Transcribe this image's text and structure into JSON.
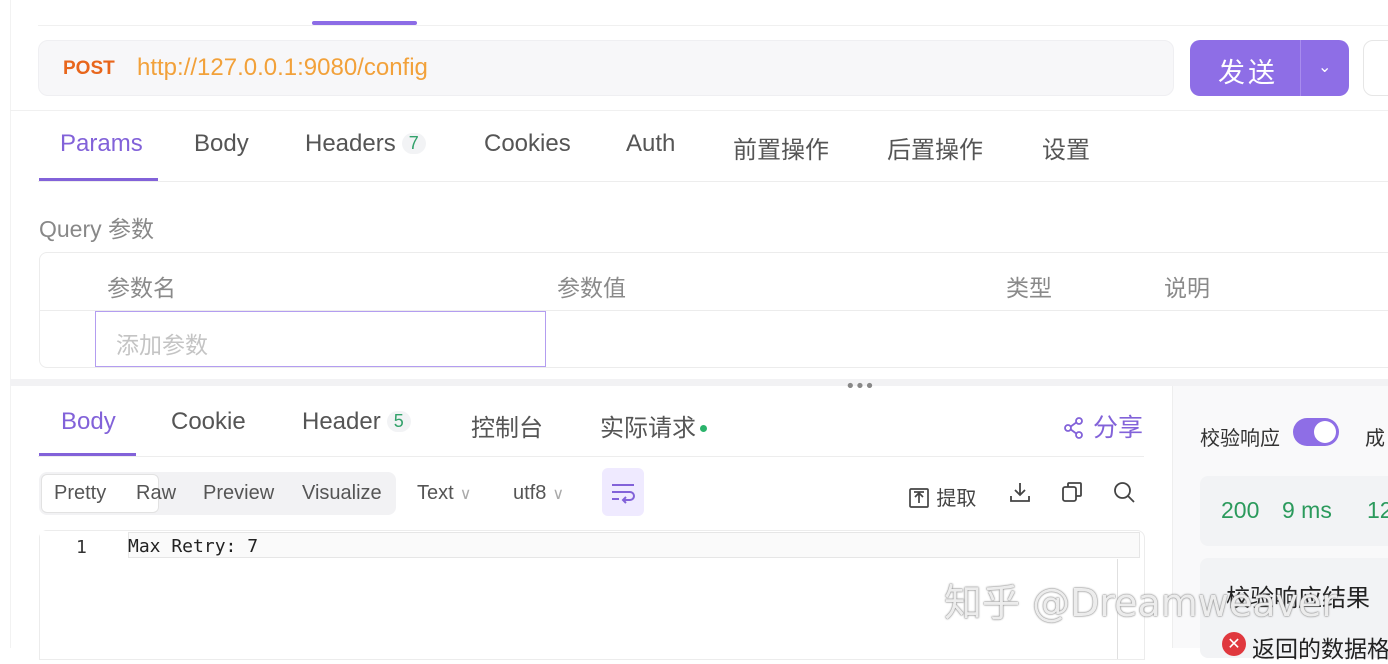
{
  "request": {
    "method": "POST",
    "url": "http://127.0.0.1:9080/config",
    "send_label": "发送"
  },
  "request_tabs": [
    {
      "label": "Params"
    },
    {
      "label": "Body"
    },
    {
      "label": "Headers",
      "badge": "7"
    },
    {
      "label": "Cookies"
    },
    {
      "label": "Auth"
    },
    {
      "label": "前置操作"
    },
    {
      "label": "后置操作"
    },
    {
      "label": "设置"
    }
  ],
  "query": {
    "title": "Query 参数",
    "columns": [
      "参数名",
      "参数值",
      "类型",
      "说明"
    ],
    "add_placeholder": "添加参数"
  },
  "response_tabs": [
    {
      "label": "Body"
    },
    {
      "label": "Cookie"
    },
    {
      "label": "Header",
      "badge": "5"
    },
    {
      "label": "控制台"
    },
    {
      "label": "实际请求"
    }
  ],
  "share_label": "分享",
  "format_modes": [
    "Pretty",
    "Raw",
    "Preview",
    "Visualize"
  ],
  "content_type": "Text",
  "encoding": "utf8",
  "extract_label": "提取",
  "editor": {
    "line_number": "1",
    "line_text": "Max Retry: 7"
  },
  "right_panel": {
    "verify_label": "校验响应",
    "success_label": "成",
    "status_code": "200",
    "time": "9 ms",
    "size": "12",
    "result_title": "校验响应结果",
    "error_text": "返回的数据格"
  },
  "watermark": "知乎 @Dreamweaver"
}
